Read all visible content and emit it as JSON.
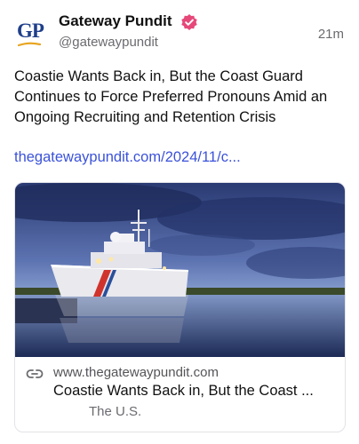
{
  "post": {
    "author_name": "Gateway Pundit",
    "avatar_text": "GP",
    "handle": "@gatewaypundit",
    "time": "21m",
    "text": "Coastie Wants Back in, But the Coast Guard Continues to Force Preferred Pronouns Amid an Ongoing Recruiting and Retention Crisis",
    "link_text": "thegatewaypundit.com/2024/11/c..."
  },
  "card": {
    "domain": "www.thegatewaypundit.com",
    "title": "Coastie Wants Back in, But the Coast ...",
    "description": "The U.S."
  },
  "colors": {
    "link": "#3b52d9",
    "verified_badge": "#e6487a",
    "avatar_text": "#1f3f8a",
    "avatar_swoosh": "#e8a623"
  },
  "icons": {
    "verified": "verified-badge-icon",
    "card_link": "link-icon"
  }
}
